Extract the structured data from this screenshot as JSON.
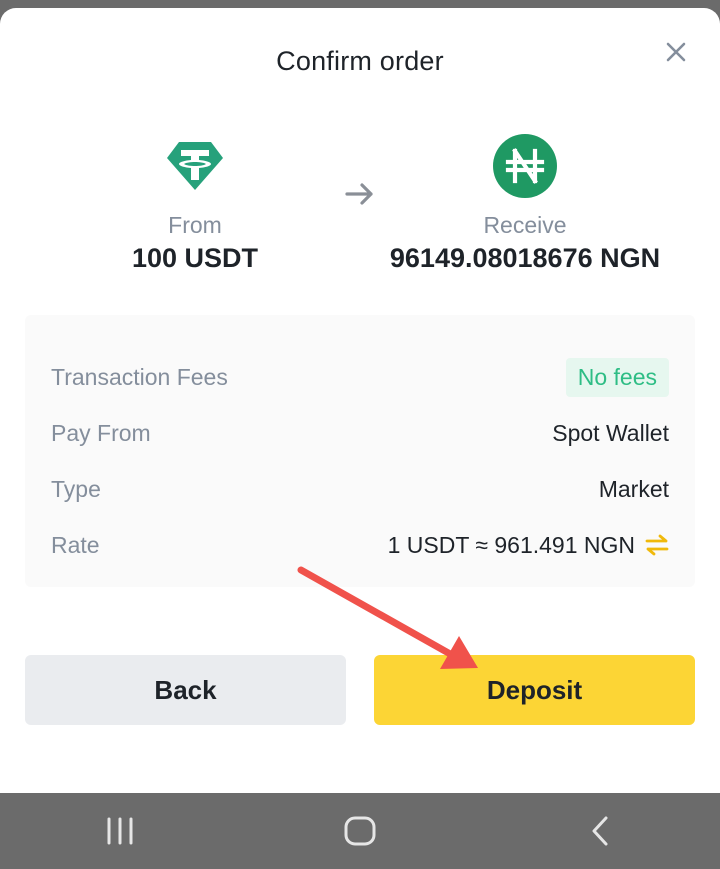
{
  "header": {
    "title": "Confirm order"
  },
  "from": {
    "label": "From",
    "amount": "100 USDT",
    "icon": "tether-icon"
  },
  "to": {
    "label": "Receive",
    "amount": "96149.08018676 NGN",
    "icon": "naira-icon"
  },
  "details": {
    "rows": [
      {
        "key": "Transaction Fees",
        "value": "No fees"
      },
      {
        "key": "Pay From",
        "value": "Spot Wallet"
      },
      {
        "key": "Type",
        "value": "Market"
      },
      {
        "key": "Rate",
        "value": "1 USDT ≈ 961.491 NGN"
      }
    ]
  },
  "buttons": {
    "back": "Back",
    "deposit": "Deposit"
  },
  "colors": {
    "accent": "#fcd535",
    "tether": "#26a17b",
    "success": "#2ebd85",
    "annotation": "#f0524b"
  }
}
